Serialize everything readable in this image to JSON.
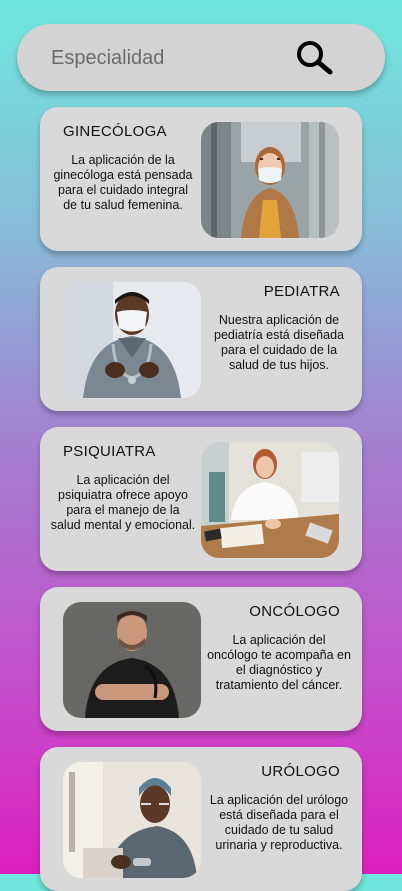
{
  "search": {
    "placeholder": "Especialidad",
    "icon": "search-icon"
  },
  "specialties": [
    {
      "title": "GINECÓLOGA",
      "description": "La aplicación de la ginecóloga está pensada para el cuidado integral de tu salud femenina.",
      "photo": "woman-face-mask-photo"
    },
    {
      "title": "PEDIATRA",
      "description": "Nuestra aplicación de pediatría está diseñada para el cuidado de la salud de tus hijos.",
      "photo": "male-doctor-mask-stethoscope-photo"
    },
    {
      "title": "PSIQUIATRA",
      "description": "La aplicación del psiquiatra ofrece apoyo para el manejo de la salud mental y emocional.",
      "photo": "female-doctor-at-desk-photo"
    },
    {
      "title": "ONCÓLOGO",
      "description": "La aplicación del oncólogo te acompaña en el diagnóstico y tratamiento del cáncer.",
      "photo": "male-doctor-arms-crossed-photo"
    },
    {
      "title": "URÓLOGO",
      "description": "La aplicación del urólogo está diseñada para el cuidado de tu salud urinaria y reproductiva.",
      "photo": "male-doctor-surgical-cap-photo"
    }
  ]
}
